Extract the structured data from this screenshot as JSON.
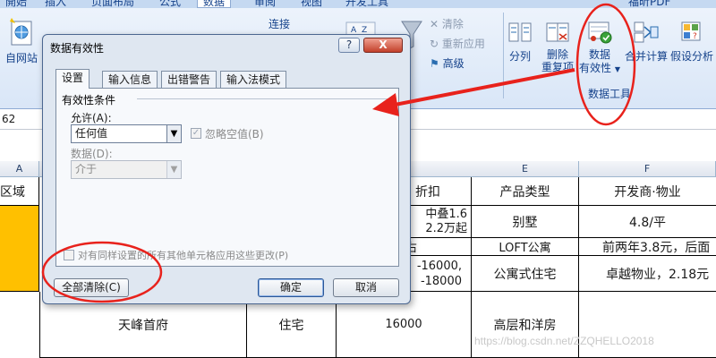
{
  "ribbon": {
    "tabs": [
      "開始",
      "插入",
      "页面布局",
      "公式",
      "数据",
      "审阅",
      "视图",
      "开发工具",
      "福昕PDF"
    ],
    "active_tab_index": 4,
    "web_button_label": "自网站",
    "connect_label": "连接",
    "clear_label": "清除",
    "reapply_label": "重新应用",
    "advanced_label": "高级",
    "text_to_columns_label": "分列",
    "remove_duplicates_label_1": "删除",
    "remove_duplicates_label_2": "重复项",
    "data_validation_label_1": "数据",
    "data_validation_label_2": "有效性",
    "consolidate_label": "合并计算",
    "what_if_label": "假设分析",
    "group_label_data_tools": "数据工具"
  },
  "formula_bar": {
    "cell_ref": "62"
  },
  "grid": {
    "columns": [
      {
        "id": "A",
        "label": "A"
      },
      {
        "id": "E",
        "label": "E"
      },
      {
        "id": "F",
        "label": "F"
      }
    ],
    "header_row": {
      "a": "区域",
      "price": "折扣",
      "type": "产品类型",
      "developer": "开发商·物业"
    },
    "rows": [
      {
        "price_1": "中叠1.6",
        "price_2": "2.2万起",
        "type": "别墅",
        "developer": "4.8/平"
      },
      {
        "price_1": "左右",
        "price_2": "",
        "type": "LOFT公寓",
        "developer": "前两年3.8元，后面"
      },
      {
        "price_1": "-16000,",
        "price_2": "-18000",
        "type": "公寓式住宅",
        "developer": "卓越物业，2.18元"
      },
      {
        "name": "天峰首府",
        "category": "住宅",
        "price": "16000",
        "type": "高层和洋房",
        "developer": ""
      }
    ]
  },
  "dialog": {
    "title": "数据有效性",
    "help_label": "?",
    "close_label": "X",
    "tabs": [
      "设置",
      "输入信息",
      "出错警告",
      "输入法模式"
    ],
    "active_tab_index": 0,
    "section_label": "有效性条件",
    "allow_label": "允许(A):",
    "allow_value": "任何值",
    "ignore_blank_label": "忽略空值(B)",
    "data_label": "数据(D):",
    "data_value": "介于",
    "apply_all_label": "对有同样设置的所有其他单元格应用这些更改(P)",
    "clear_all_label": "全部清除(C)",
    "ok_label": "确定",
    "cancel_label": "取消"
  },
  "colors": {
    "annotation_red": "#e8221c",
    "orange_fill": "#ffc000",
    "ribbon_text": "#15428b"
  },
  "watermark": "https://blog.csdn.net/ZZQHELLO2018"
}
